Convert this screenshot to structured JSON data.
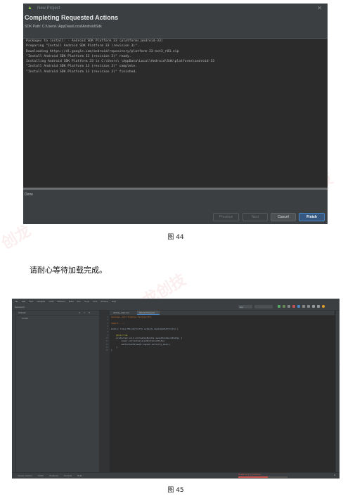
{
  "figure1": {
    "window_title": "New Project",
    "dialog_title": "Completing Requested Actions",
    "sdk_path": "SDK Path: C:\\Users\\ \\AppData\\Local\\Android\\Sdk",
    "console_lines": [
      "Packages to install: - Android SDK Platform 33 (platforms;android-33)",
      "",
      "",
      "Preparing \"Install Android SDK Platform 33 (revision 3)\".",
      "Downloading https://dl.google.com/android/repository/platform-33-ext3_r03.zip",
      "\"Install Android SDK Platform 33 (revision 3)\" ready.",
      "Installing Android SDK Platform 33 in C:\\Users\\ \\AppData\\Local\\Android\\Sdk\\platforms\\android-33",
      "\"Install Android SDK Platform 33 (revision 3)\" complete.",
      "\"Install Android SDK Platform 33 (revision 3)\" finished."
    ],
    "status": "Done",
    "buttons": {
      "previous": "Previous",
      "next": "Next",
      "cancel": "Cancel",
      "finish": "Finish"
    },
    "caption": "图 44"
  },
  "instruction_text": "请耐心等待加载完成。",
  "figure2": {
    "menu_items": [
      "File",
      "Edit",
      "View",
      "Navigate",
      "Code",
      "Refactor",
      "Build",
      "Run",
      "Tools",
      "VCS",
      "Window",
      "Help"
    ],
    "breadcrumb": "helloworld",
    "run_config": "app",
    "project_panel_title": "Android",
    "project_item": "Gradle",
    "editor_tabs": [
      "activity_main.xml",
      "MainActivity.java"
    ],
    "code_lines": [
      "package com.liceking.helloworld;",
      "",
      "import ...;",
      "",
      "public class MainActivity extends AppCompatActivity {",
      "",
      "    @Override",
      "    protected void onCreate(Bundle savedInstanceState) {",
      "        super.onCreate(savedInstanceState);",
      "        setContentView(R.layout.activity_main);",
      "    }",
      "}"
    ],
    "line_numbers": [
      "1",
      "2",
      "3",
      "6",
      "7",
      "8",
      "9",
      "10",
      "11",
      "12",
      "13",
      "14"
    ],
    "bottom_tools": [
      "Version Control",
      "TODO",
      "Problems",
      "Terminal",
      "Build"
    ],
    "sync_text": "Gradle sync in progress...",
    "caption": "图 45"
  }
}
